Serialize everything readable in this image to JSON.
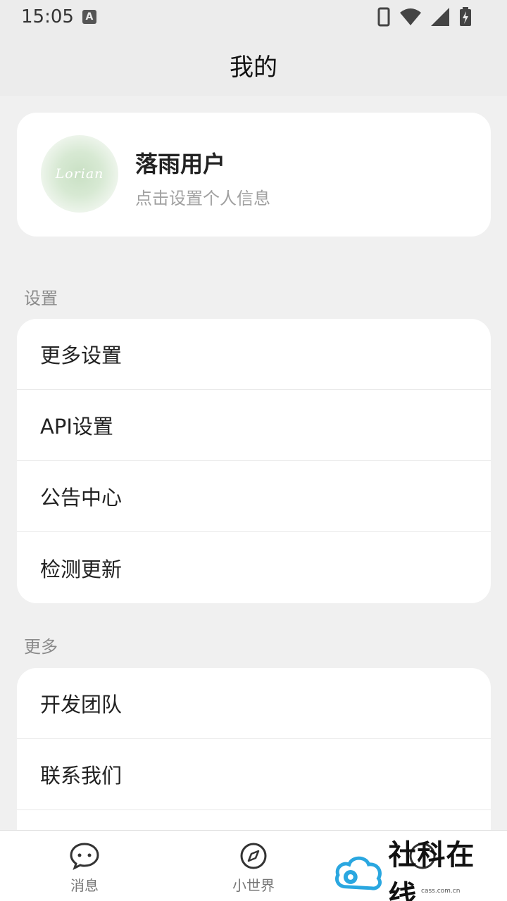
{
  "status_bar": {
    "time": "15:05",
    "indicator": "A",
    "icons": [
      "phone-icon",
      "wifi-icon",
      "signal-icon",
      "battery-charging-icon"
    ]
  },
  "header": {
    "title": "我的"
  },
  "profile": {
    "avatar_text": "Lorian",
    "name": "落雨用户",
    "subtitle": "点击设置个人信息"
  },
  "settings_section": {
    "label": "设置",
    "items": [
      {
        "label": "更多设置"
      },
      {
        "label": "API设置"
      },
      {
        "label": "公告中心"
      },
      {
        "label": "检测更新"
      }
    ]
  },
  "more_section": {
    "label": "更多",
    "items": [
      {
        "label": "开发团队"
      },
      {
        "label": "联系我们"
      }
    ]
  },
  "bottom_nav": {
    "items": [
      {
        "label": "消息",
        "icon": "chat-icon"
      },
      {
        "label": "小世界",
        "icon": "compass-icon"
      },
      {
        "label": "",
        "icon": "profile-icon"
      }
    ]
  },
  "watermark": {
    "text": "社科在线",
    "small": "cass.com.cn"
  }
}
